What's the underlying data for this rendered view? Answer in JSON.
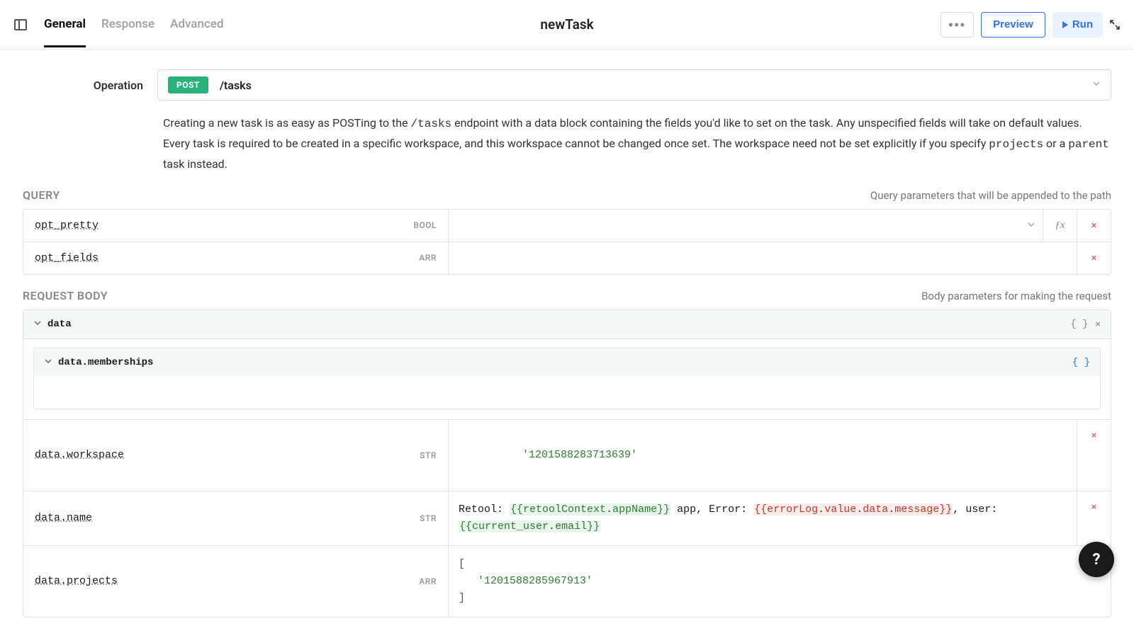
{
  "header": {
    "tabs": {
      "general": "General",
      "response": "Response",
      "advanced": "Advanced"
    },
    "title": "newTask",
    "preview": "Preview",
    "run": "Run"
  },
  "operation": {
    "label": "Operation",
    "method": "POST",
    "path": "/tasks",
    "description_1": "Creating a new task is as easy as POSTing to the ",
    "description_code": "/tasks",
    "description_2": " endpoint with a data block containing the fields you'd like to set on the task. Any unspecified fields will take on default values.",
    "description_3a": "Every task is required to be created in a specific workspace, and this workspace cannot be changed once set. The workspace need not be set explicitly if you specify ",
    "description_3_code1": "projects",
    "description_3b": " or a ",
    "description_3_code2": "parent",
    "description_3c": " task instead."
  },
  "query": {
    "title": "QUERY",
    "hint": "Query parameters that will be appended to the path",
    "rows": {
      "opt_pretty": {
        "name": "opt_pretty",
        "type": "BOOL"
      },
      "opt_fields": {
        "name": "opt_fields",
        "type": "ARR"
      }
    }
  },
  "body": {
    "title": "REQUEST BODY",
    "hint": "Body parameters for making the request",
    "data_label": "data",
    "memberships_label": "data.memberships",
    "rows": {
      "workspace": {
        "key": "data.workspace",
        "type": "STR",
        "value": "'1201588283713639'"
      },
      "name": {
        "key": "data.name",
        "type": "STR",
        "plain_value": "Retool: {{retoolContext.appName}} app, Error: {{errorLog.value.data.message}}, user: {{current_user.email}}",
        "prefix": "Retool: ",
        "bind1_open": "{{",
        "bind1_a": "retoolContext",
        "bind1_dot": ".",
        "bind1_b": "appName",
        "bind1_close": "}}",
        "mid1": " app, Error: ",
        "bind2_open": "{{",
        "bind2_a": "errorLog",
        "bind2_dot1": ".",
        "bind2_b": "value",
        "bind2_dot2": ".",
        "bind2_c": "data",
        "bind2_dot3": ".",
        "bind2_d": "message",
        "bind2_close": "}}",
        "mid2": ", user: ",
        "bind3_open": "{{",
        "bind3_a": "current_user",
        "bind3_dot": ".",
        "bind3_b": "email",
        "bind3_close": "}}"
      },
      "projects": {
        "key": "data.projects",
        "type": "ARR",
        "line1": "[",
        "line2": "   '1201588285967913'",
        "line3": "]"
      }
    }
  },
  "icons": {
    "fx": "ƒx",
    "close": "×",
    "braces": "{ }",
    "help": "?"
  }
}
